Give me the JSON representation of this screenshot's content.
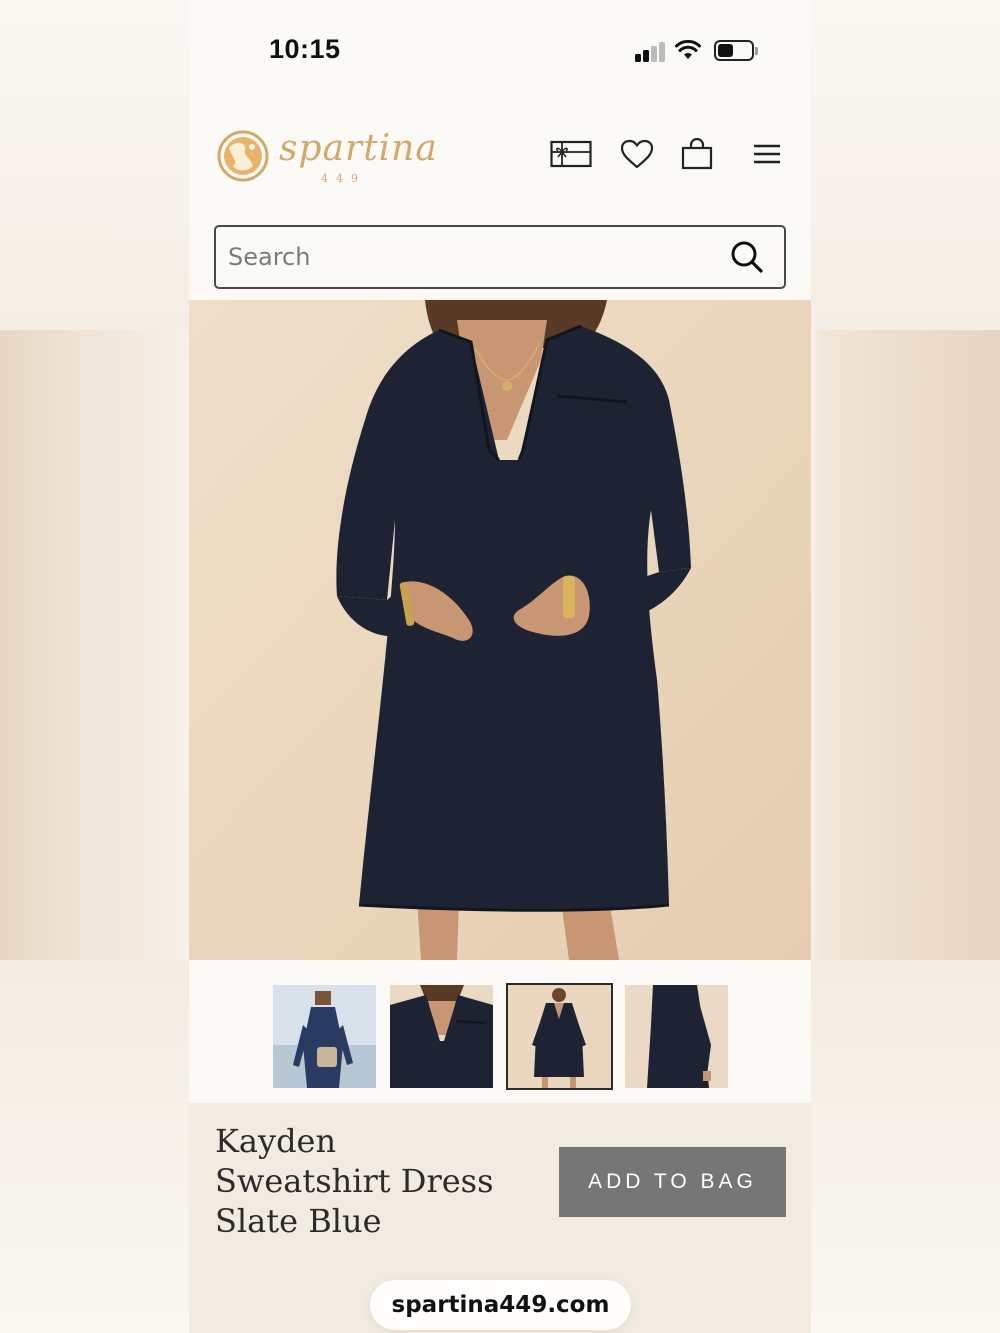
{
  "status_bar": {
    "time": "10:15",
    "signal_bars": 2,
    "battery_level": 0.45
  },
  "brand": {
    "name": "spartina",
    "suffix": "449",
    "color": "#d4a76a"
  },
  "header": {
    "icons": [
      "gift-card-icon",
      "heart-icon",
      "shopping-bag-icon",
      "menu-icon"
    ]
  },
  "search": {
    "placeholder": "Search",
    "value": ""
  },
  "gallery": {
    "thumbnails": [
      "model-with-crossbody-bag",
      "v-neck-collar-detail",
      "dress-front-full",
      "dress-side-view"
    ],
    "selected_index": 2
  },
  "product": {
    "name_lines": [
      "Kayden",
      "Sweatshirt Dress",
      "Slate Blue"
    ],
    "add_to_bag_label": "ADD TO BAG"
  },
  "browser": {
    "url": "spartina449.com"
  },
  "colors": {
    "dress": "#1d2333",
    "button": "#767676",
    "background": "#fcfaf6",
    "info_bar": "#f2ebe1"
  }
}
